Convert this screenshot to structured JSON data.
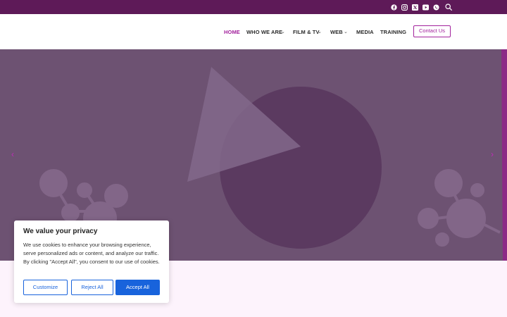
{
  "topbar": {
    "social_icons": [
      "facebook-icon",
      "instagram-icon",
      "x-twitter-icon",
      "youtube-icon",
      "whatsapp-icon"
    ],
    "search_icon": "search-icon"
  },
  "nav": {
    "items": [
      {
        "label": "HOME",
        "active": true,
        "has_dropdown": false
      },
      {
        "label": "WHO WE ARE",
        "active": false,
        "has_dropdown": true
      },
      {
        "label": "FILM & TV",
        "active": false,
        "has_dropdown": true
      },
      {
        "label": "WEB",
        "active": false,
        "has_dropdown": true
      },
      {
        "label": "MEDIA",
        "active": false,
        "has_dropdown": false
      },
      {
        "label": "TRAINING",
        "active": false,
        "has_dropdown": false
      }
    ],
    "contact_label": "Contact Us"
  },
  "hero": {
    "prev_arrow": "‹",
    "next_arrow": "›"
  },
  "cookie_banner": {
    "title": "We value your privacy",
    "body": "We use cookies to enhance your browsing experience, serve personalized ads or content, and analyze our traffic. By clicking \"Accept All\", you consent to our use of cookies.",
    "customize_label": "Customize",
    "reject_label": "Reject All",
    "accept_label": "Accept All"
  },
  "colors": {
    "brand_purple": "#5e1a58",
    "accent_magenta": "#a2219c",
    "hero_bg": "#6d5272",
    "cookie_blue": "#1863dc"
  }
}
